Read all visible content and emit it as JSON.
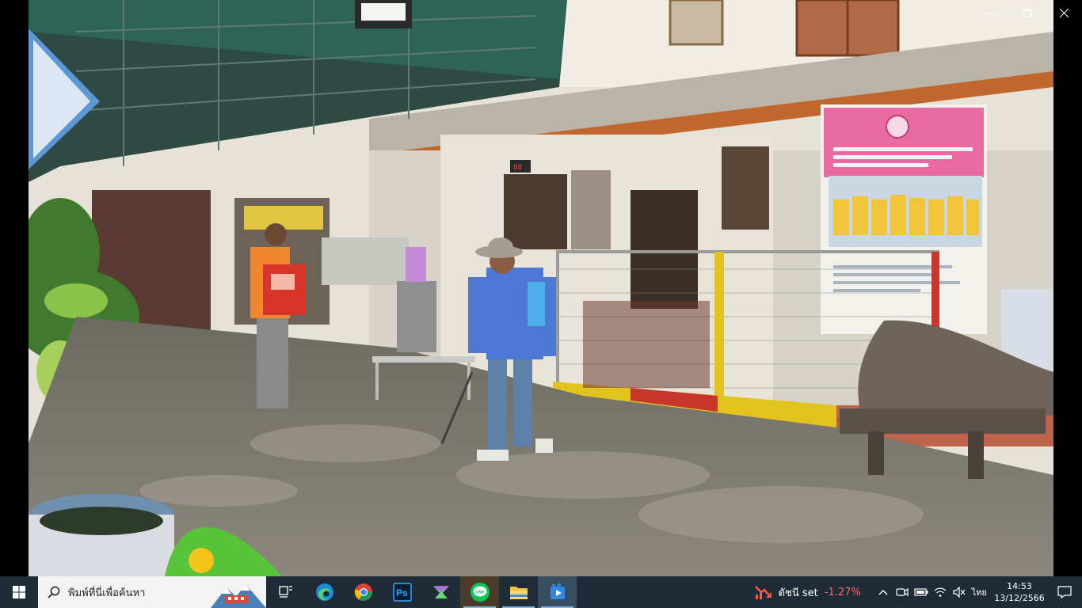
{
  "window": {
    "controls": [
      "minimize-icon",
      "restore-icon",
      "close-icon"
    ]
  },
  "video": {
    "content": "frame"
  },
  "taskbar": {
    "start_icon": "windows-logo-icon",
    "search": {
      "placeholder": "พิมพ์ที่นี่เพื่อค้นหา"
    },
    "apps": [
      {
        "name": "task-view",
        "icon": "task-view-icon"
      },
      {
        "name": "edge",
        "icon": "edge-icon"
      },
      {
        "name": "chrome",
        "icon": "chrome-icon"
      },
      {
        "name": "photoshop",
        "icon": "photoshop-icon",
        "label": "Ps"
      },
      {
        "name": "filmora",
        "icon": "filmora-icon"
      },
      {
        "name": "line",
        "icon": "line-icon",
        "label": "LINE"
      },
      {
        "name": "file-explorer",
        "icon": "folder-icon"
      },
      {
        "name": "video-player",
        "icon": "video-player-icon"
      }
    ],
    "stock": {
      "name": "ดัชนี set",
      "change": "-1.27%",
      "color": "#ff6a6a"
    },
    "language": "ไทย",
    "time": "14:53",
    "date": "13/12/2566"
  }
}
